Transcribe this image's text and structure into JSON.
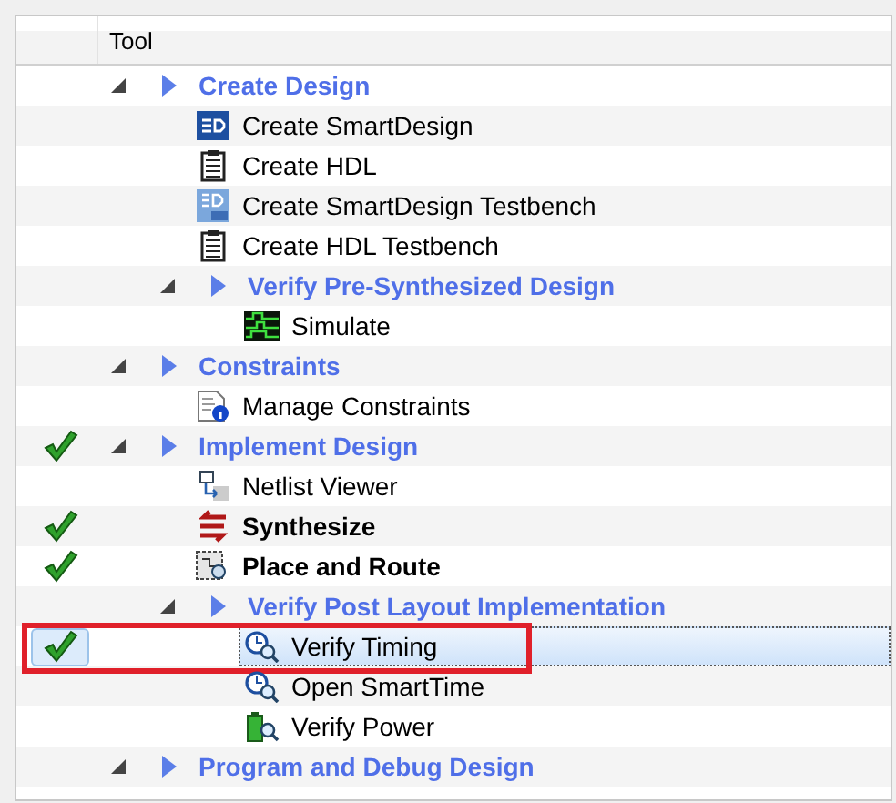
{
  "tree": {
    "column": "Tool",
    "items": [
      {
        "kind": "group",
        "label": "Create Design",
        "expanded": true,
        "done": false,
        "children": [
          {
            "kind": "smartdesign",
            "label": "Create SmartDesign",
            "done": false,
            "bold": false,
            "selected": false,
            "highlighted": false
          },
          {
            "kind": "document",
            "label": "Create HDL",
            "done": false,
            "bold": false,
            "selected": false,
            "highlighted": false
          },
          {
            "kind": "testbench",
            "label": "Create SmartDesign Testbench",
            "done": false,
            "bold": false,
            "selected": false,
            "highlighted": false
          },
          {
            "kind": "document",
            "label": "Create HDL Testbench",
            "done": false,
            "bold": false,
            "selected": false,
            "highlighted": false
          },
          {
            "kind": "group",
            "label": "Verify Pre-Synthesized Design",
            "expanded": true,
            "done": false,
            "children": [
              {
                "kind": "waveform",
                "label": "Simulate",
                "done": false,
                "bold": false,
                "selected": false,
                "highlighted": false
              }
            ]
          }
        ]
      },
      {
        "kind": "group",
        "label": "Constraints",
        "expanded": true,
        "done": false,
        "children": [
          {
            "kind": "constraints",
            "label": "Manage Constraints",
            "done": false,
            "bold": false,
            "selected": false,
            "highlighted": false
          }
        ]
      },
      {
        "kind": "group",
        "label": "Implement Design",
        "expanded": true,
        "done": true,
        "children": [
          {
            "kind": "netlist",
            "label": "Netlist Viewer",
            "done": false,
            "bold": false,
            "selected": false,
            "highlighted": false
          },
          {
            "kind": "synth",
            "label": "Synthesize",
            "done": true,
            "bold": true,
            "selected": false,
            "highlighted": false
          },
          {
            "kind": "layout",
            "label": "Place and Route",
            "done": true,
            "bold": true,
            "selected": false,
            "highlighted": false
          },
          {
            "kind": "group",
            "label": "Verify Post Layout Implementation",
            "expanded": true,
            "done": false,
            "children": [
              {
                "kind": "timing",
                "label": "Verify Timing",
                "done": true,
                "bold": false,
                "selected": true,
                "highlighted": true
              },
              {
                "kind": "timing",
                "label": "Open SmartTime",
                "done": false,
                "bold": false,
                "selected": false,
                "highlighted": false
              },
              {
                "kind": "power",
                "label": "Verify Power",
                "done": false,
                "bold": false,
                "selected": false,
                "highlighted": false
              }
            ]
          }
        ]
      },
      {
        "kind": "group",
        "label": "Program and Debug Design",
        "expanded": true,
        "done": false
      }
    ]
  }
}
